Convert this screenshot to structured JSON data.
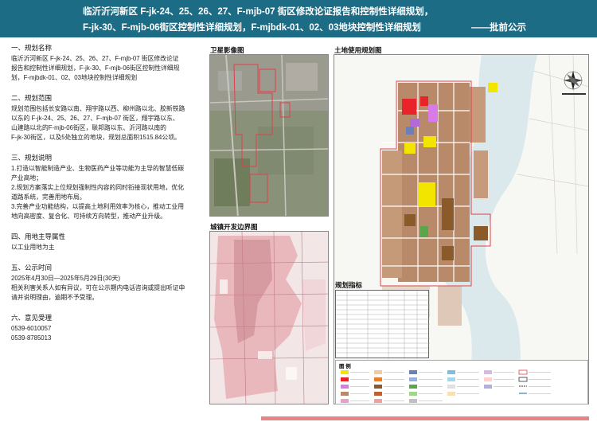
{
  "header": {
    "title_line1": "临沂沂河新区 F-jk-24、25、26、27、F-mjb-07 街区修改论证报告和控制性详细规划，",
    "title_line2": "F-jk-30、F-mjb-06街区控制性详细规划，F-mjbdk-01、02、03地块控制性详细规划",
    "tag": "——批前公示"
  },
  "sections": {
    "s1": {
      "heading": "一、规划名称",
      "lines": [
        "临沂沂河新区 F-jk-24、25、26、27、F-mjb-07 街区修改论证",
        "报告和控制性详细规划，F-jk-30、F-mjb-06街区控制性详细规",
        "划，F-mjbdk-01、02、03地块控制性详细规划"
      ]
    },
    "s2": {
      "heading": "二、规划范围",
      "lines": [
        "规划范围包括长安路以南、翔宇路以西、柳州路以北、胶新铁路",
        "以东的 F-jk-24、25、26、27、F-mjb-07 街区，翔宇路以东、",
        "山建路以北的F-mjb-06街区，联邦路以东、沂河路以南的",
        "F-jk-30街区，以及5处独立的地块，规划总面积1515.84公顷。"
      ]
    },
    "s3": {
      "heading": "三、规划说明",
      "lines": [
        "1.打造以智能制造产业、生物医药产业等功能为主导的智慧低碳",
        "产业高地；",
        "2.规划方案落实上位规划强制性内容的同时衔接现状用地，优化",
        "道路系统，完善用地布局。",
        "3.完善产业功能结构，以提高土地利用效率为核心，推动工业用",
        "地向高密度、复合化、可持续方向转型，推动产业升级。"
      ]
    },
    "s4": {
      "heading": "四、用地主导属性",
      "lines": [
        "以工业用地为主"
      ]
    },
    "s5": {
      "heading": "五、公示时间",
      "lines": [
        "2025年4月30日—2025年5月29日(30天)",
        "相关利害关系人如有异议，可在公示期内电话咨询或提出听证申",
        "请并说明理由，逾期不予受理。"
      ]
    },
    "s6": {
      "heading": "六、意见受理",
      "lines": [
        "0539-6010057",
        "0539-8785013"
      ]
    }
  },
  "panels": {
    "satellite_title": "卫星影像图",
    "boundary_title": "城镇开发边界图",
    "landuse_title": "土地使用规划图",
    "indicators_title": "规划指标",
    "legend_title": "图 例"
  },
  "colors": {
    "header_bg": "#1d6c86",
    "industrial": "#8b5a2b",
    "commercial": "#e8242a",
    "residential": "#f2e600",
    "public": "#e07cf0",
    "boundary": "#e0404a",
    "footer_text": "#d42020"
  }
}
